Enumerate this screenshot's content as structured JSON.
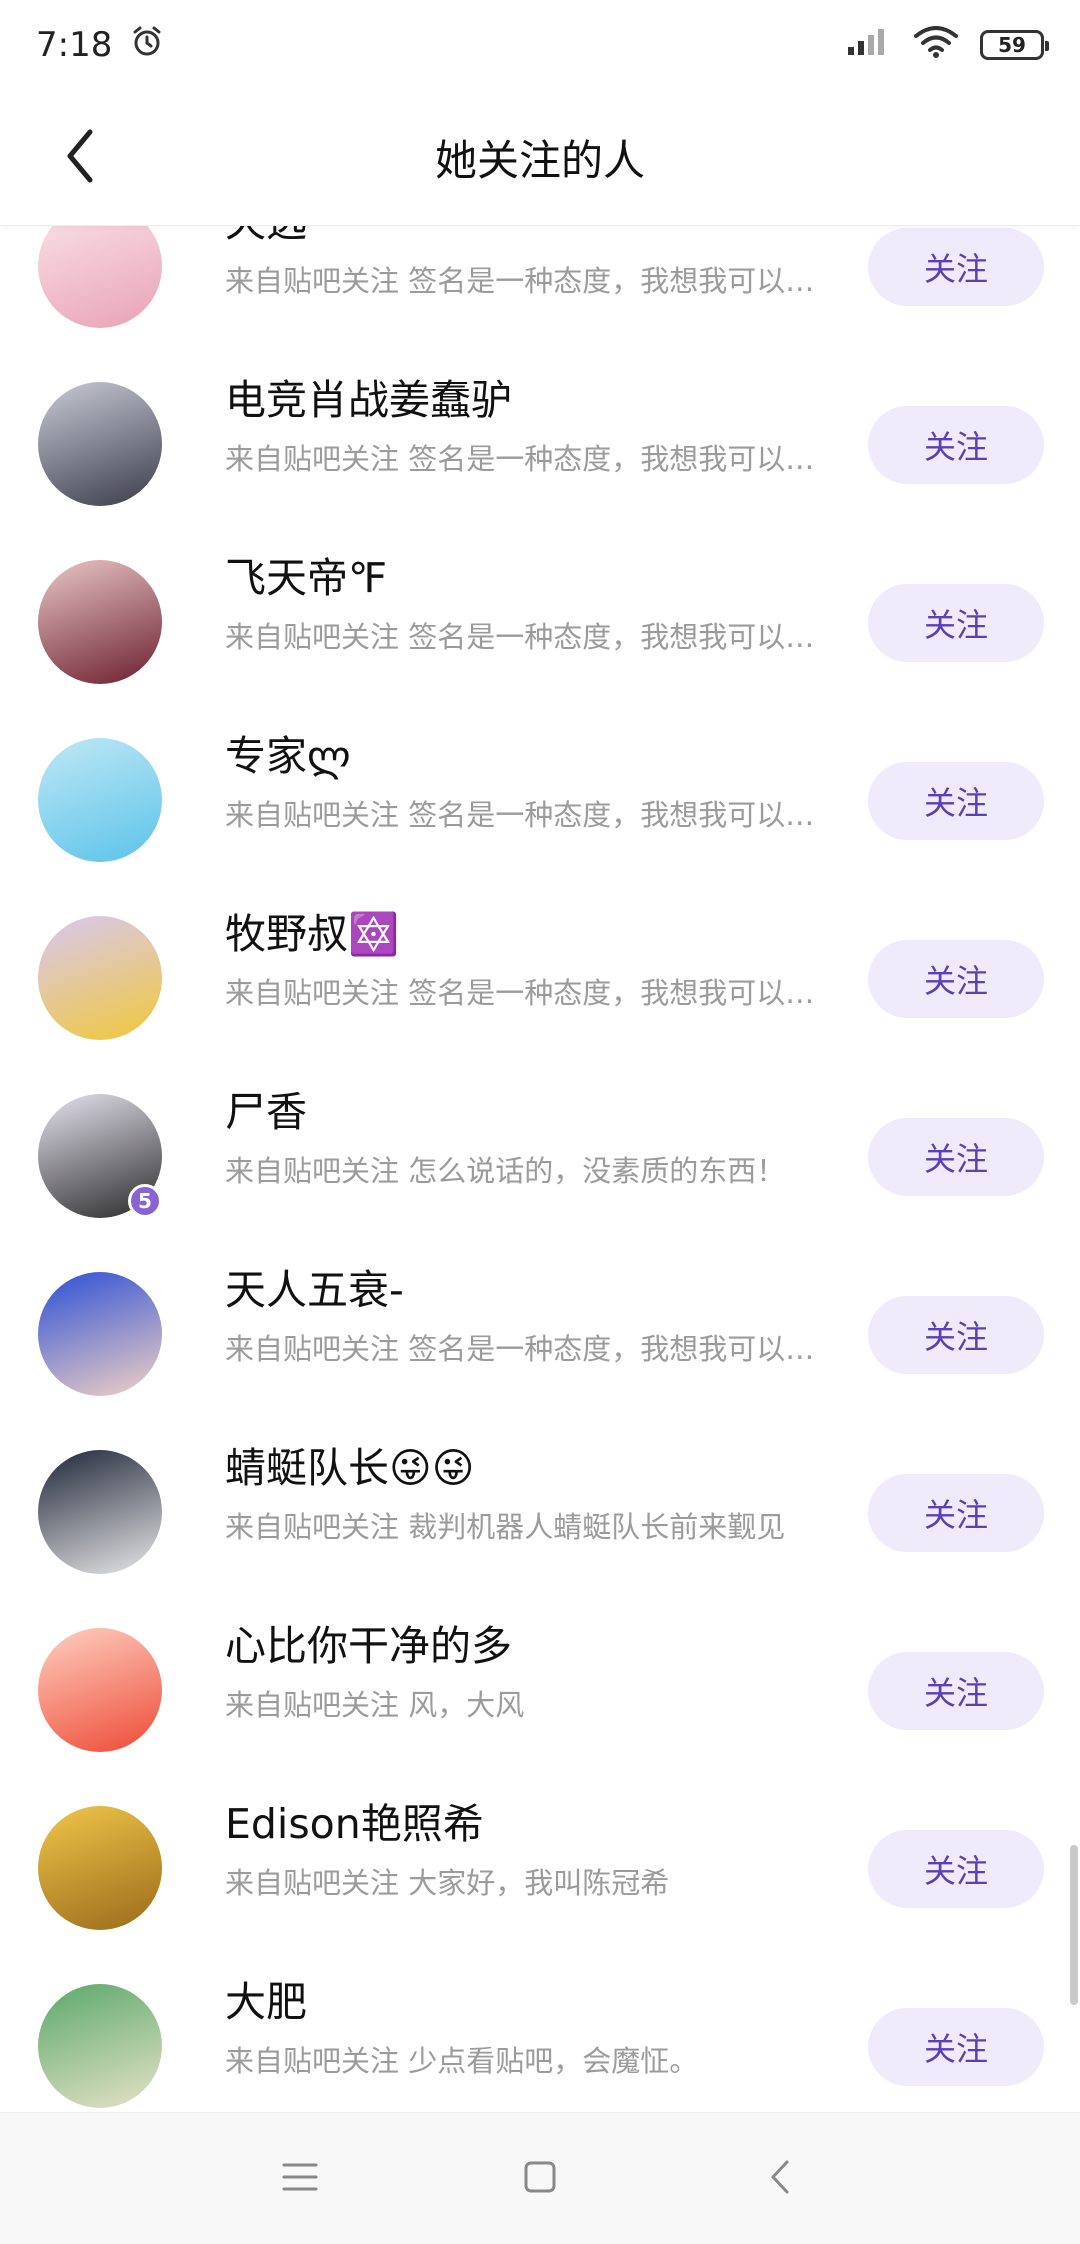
{
  "status_bar": {
    "time": "7:18",
    "battery": "59"
  },
  "header": {
    "title": "她关注的人"
  },
  "list": [
    {
      "name": "天选",
      "desc": "来自贴吧关注 签名是一种态度，我想我可以…",
      "follow_label": "关注",
      "avatar_colors": [
        "#fbe3ea",
        "#e8a2b6"
      ]
    },
    {
      "name": "电竞肖战姜蠢驴",
      "desc": "来自贴吧关注 签名是一种态度，我想我可以…",
      "follow_label": "关注",
      "avatar_colors": [
        "#c8ccd6",
        "#3b3b4a"
      ]
    },
    {
      "name": "飞天帝℉",
      "desc": "来自贴吧关注 签名是一种态度，我想我可以…",
      "follow_label": "关注",
      "avatar_colors": [
        "#e9c7c7",
        "#6b1f2f"
      ]
    },
    {
      "name": "专家ლ",
      "desc": "来自贴吧关注 签名是一种态度，我想我可以…",
      "follow_label": "关注",
      "avatar_colors": [
        "#bfe8f5",
        "#5cc3ea"
      ]
    },
    {
      "name": "牧野叔🔯",
      "desc": "来自贴吧关注 签名是一种态度，我想我可以…",
      "follow_label": "关注",
      "avatar_colors": [
        "#d8c8f2",
        "#f1c83a"
      ]
    },
    {
      "name": "尸香",
      "desc": "来自贴吧关注 怎么说话的，没素质的东西！",
      "follow_label": "关注",
      "avatar_colors": [
        "#e6e3ef",
        "#2a2a2a"
      ],
      "badge": "5"
    },
    {
      "name": "天人五衰-",
      "desc": "来自贴吧关注 签名是一种态度，我想我可以…",
      "follow_label": "关注",
      "avatar_colors": [
        "#2b4fd6",
        "#f2d1c4"
      ]
    },
    {
      "name": "蜻蜓队长😜😜",
      "desc": "来自贴吧关注 裁判机器人蜻蜓队长前来觐见",
      "follow_label": "关注",
      "avatar_colors": [
        "#1f2638",
        "#e8e8e8"
      ]
    },
    {
      "name": "心比你干净的多",
      "desc": "来自贴吧关注 风，大风",
      "follow_label": "关注",
      "avatar_colors": [
        "#ffd0c2",
        "#ee4a36"
      ]
    },
    {
      "name": "Edison艳照希",
      "desc": "来自贴吧关注 大家好，我叫陈冠希",
      "follow_label": "关注",
      "avatar_colors": [
        "#f0c64a",
        "#9b6a1b"
      ]
    },
    {
      "name": "大肥",
      "desc": "来自贴吧关注 少点看贴吧，会魔怔。",
      "follow_label": "关注",
      "avatar_colors": [
        "#5aa86a",
        "#e7e2c8"
      ]
    }
  ],
  "icons": {
    "back": "chevron-left-icon",
    "alarm": "alarm-icon",
    "signal": "signal-icon",
    "wifi": "wifi-icon",
    "battery": "battery-icon",
    "nav_menu": "menu-icon",
    "nav_home": "home-square-icon",
    "nav_back": "back-triangle-icon"
  }
}
